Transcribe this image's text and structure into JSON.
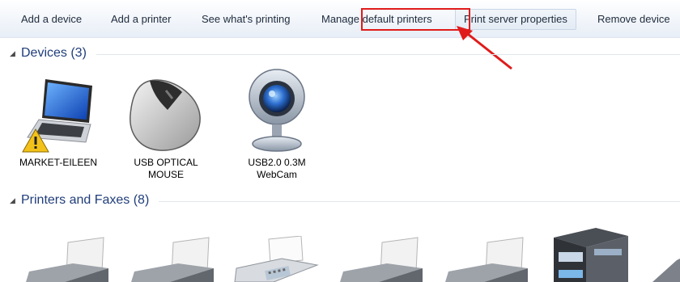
{
  "toolbar": {
    "add_device": "Add a device",
    "add_printer": "Add a printer",
    "see_printing": "See what's printing",
    "manage_default": "Manage default printers",
    "print_server": "Print server properties",
    "remove_device": "Remove device"
  },
  "groups": {
    "devices": "Devices (3)",
    "printers": "Printers and Faxes (8)"
  },
  "devices": [
    {
      "line1": "MARKET-EILEEN",
      "line2": ""
    },
    {
      "line1": "USB OPTICAL",
      "line2": "MOUSE"
    },
    {
      "line1": "USB2.0 0.3M",
      "line2": "WebCam"
    }
  ],
  "colors": {
    "highlight": "#e01b1b",
    "group_title": "#1f3d7a"
  },
  "icons": [
    "laptop-warning-icon",
    "mouse-icon",
    "webcam-icon",
    "printer-icon",
    "fax-icon",
    "multifunction-printer-icon"
  ]
}
